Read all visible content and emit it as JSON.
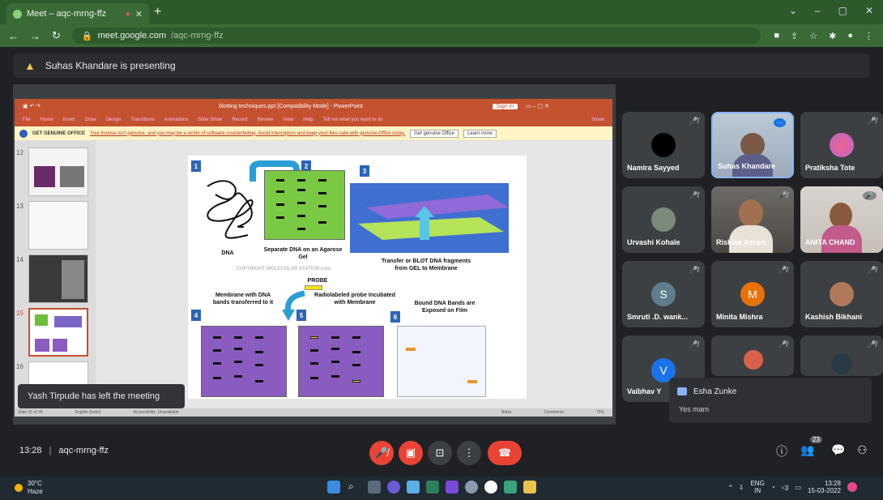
{
  "browser": {
    "tab_title": "Meet – aqc-mrng-ffz",
    "url_domain": "meet.google.com",
    "url_path": "/aqc-mrng-ffz"
  },
  "presenter_banner": "Suhas Khandare is presenting",
  "powerpoint": {
    "title": "blotting techniques.ppt [Compatibility Mode] - PowerPoint",
    "sign_in": "Sign in",
    "menu": [
      "File",
      "Home",
      "Insert",
      "Draw",
      "Design",
      "Transitions",
      "Animations",
      "Slide Show",
      "Record",
      "Review",
      "View",
      "Help",
      "Tell me what you want to do",
      "Share"
    ],
    "warning_label": "GET GENUINE OFFICE",
    "warning_text": "Your license isn't genuine, and you may be a victim of software counterfeiting. Avoid interruption and keep your files safe with genuine Office today.",
    "warning_btn1": "Get genuine Office",
    "warning_btn2": "Learn more",
    "slide_numbers": [
      "12",
      "13",
      "14",
      "15",
      "16"
    ],
    "status_left": "Slide 15 of 30",
    "status_lang": "English (India)",
    "status_access": "Accessibility: Unavailable",
    "status_notes": "Notes",
    "status_comments": "Comments",
    "zoom": "75%"
  },
  "slide": {
    "steps": [
      "1",
      "2",
      "3",
      "4",
      "5",
      "6"
    ],
    "dna": "DNA",
    "separate": "Separate DNA on an Agarose Gel",
    "copyright": "COPYRIGHT MOLECULAR STATION.com",
    "transfer": "Transfer or BLOT DNA fragments from GEL to Membrane",
    "probe": "PROBE",
    "membrane": "Membrane with DNA bands transferred to it",
    "radiolabeled": "Radiolabeled probe Incubated with Membrane",
    "bound": "Bound DNA Bands are Exposed on Film"
  },
  "toast": "Yash Tirpude has left the meeting",
  "participants": [
    {
      "name": "Namira Sayyed",
      "initial": "",
      "color": "#000000"
    },
    {
      "name": "Suhas Khandare",
      "initial": "",
      "color": ""
    },
    {
      "name": "Pratiksha Tote",
      "initial": "",
      "color": ""
    },
    {
      "name": "Urvashi Kohale",
      "initial": "",
      "color": ""
    },
    {
      "name": "Rishika Asrani",
      "initial": "",
      "color": ""
    },
    {
      "name": "ANITA CHAND",
      "initial": "",
      "color": ""
    },
    {
      "name": "Smruti .D. wank...",
      "initial": "S",
      "color": "#5f7d8c"
    },
    {
      "name": "Minita Mishra",
      "initial": "M",
      "color": "#e8710a"
    },
    {
      "name": "Kashish Bikhani",
      "initial": "",
      "color": ""
    },
    {
      "name": "Vaibhav Y",
      "initial": "V",
      "color": "#1a73e8"
    }
  ],
  "chat": {
    "sender": "Esha Zunke",
    "message": "Yes mam"
  },
  "meeting": {
    "time": "13:28",
    "code": "aqc-mrng-ffz",
    "people_count": "23"
  },
  "taskbar": {
    "temp": "30°C",
    "weather": "Haze",
    "lang1": "ENG",
    "lang2": "IN",
    "clock_time": "13:28",
    "clock_date": "15-03-2022"
  }
}
